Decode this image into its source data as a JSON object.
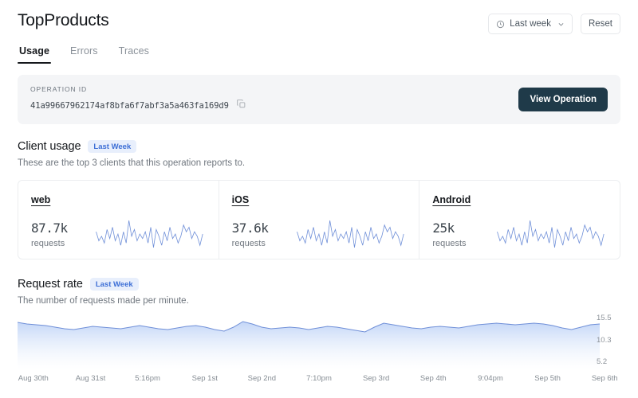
{
  "header": {
    "title": "TopProducts",
    "time_range_label": "Last week",
    "time_range_icon": "clock-icon",
    "chevron_icon": "chevron-down-icon",
    "reset_label": "Reset"
  },
  "tabs": [
    {
      "label": "Usage",
      "active": true
    },
    {
      "label": "Errors",
      "active": false
    },
    {
      "label": "Traces",
      "active": false
    }
  ],
  "operation": {
    "label": "OPERATION ID",
    "id": "41a99667962174af8bfa6f7abf3a5a463fa169d9",
    "copy_icon": "copy-icon",
    "view_button_label": "View Operation"
  },
  "client_usage": {
    "title": "Client usage",
    "badge": "Last Week",
    "description": "These are the top 3 clients that this operation reports to.",
    "cards": [
      {
        "name": "web",
        "value": "87.7k",
        "unit": "requests"
      },
      {
        "name": "iOS",
        "value": "37.6k",
        "unit": "requests"
      },
      {
        "name": "Android",
        "value": "25k",
        "unit": "requests"
      }
    ]
  },
  "request_rate": {
    "title": "Request rate",
    "badge": "Last Week",
    "description": "The number of requests made per minute."
  },
  "colors": {
    "accent_line": "#6f8fd8",
    "area_fill_top": "#c3d6f7",
    "badge_bg": "#e8effc",
    "badge_text": "#3d6fd6",
    "primary_button_bg": "#1f3a49",
    "panel_bg": "#f4f5f7"
  },
  "chart_data": {
    "type": "area",
    "title": "Request rate",
    "subtitle": "The number of requests made per minute.",
    "xlabel": "",
    "ylabel": "",
    "grid": false,
    "legend": false,
    "ytick_labels": [
      "15.5",
      "10.3",
      "5.2"
    ],
    "ytick_values": [
      15.5,
      10.3,
      5.2
    ],
    "ylim": [
      0,
      16.5
    ],
    "xtick_labels": [
      "Aug 30th",
      "Aug 31st",
      "5:16pm",
      "Sep 1st",
      "Sep 2nd",
      "7:10pm",
      "Sep 3rd",
      "Sep 4th",
      "9:04pm",
      "Sep 5th",
      "Sep 6th"
    ],
    "values": [
      15.5,
      15.3,
      15.2,
      15.1,
      14.9,
      14.7,
      14.6,
      14.8,
      15.0,
      14.9,
      14.8,
      14.7,
      14.9,
      15.1,
      14.9,
      14.7,
      14.6,
      14.8,
      15.0,
      15.1,
      14.9,
      14.6,
      14.4,
      14.9,
      15.6,
      15.3,
      14.9,
      14.7,
      14.8,
      14.9,
      14.8,
      14.6,
      14.8,
      15.0,
      14.9,
      14.7,
      14.5,
      14.3,
      14.9,
      15.4,
      15.2,
      15.0,
      14.8,
      14.7,
      14.9,
      15.0,
      14.9,
      14.8,
      15.0,
      15.2,
      15.3,
      15.4,
      15.3,
      15.2,
      15.3,
      15.4,
      15.3,
      15.1,
      14.8,
      14.6,
      14.9,
      15.2,
      15.3
    ]
  },
  "sparkline_data": {
    "type": "line",
    "shared_series_values": [
      9,
      5,
      7,
      4,
      10,
      6,
      11,
      5,
      8,
      3,
      9,
      4,
      14,
      7,
      10,
      5,
      8,
      6,
      9,
      4,
      11,
      2,
      10,
      7,
      3,
      9,
      5,
      11,
      6,
      8,
      4,
      7,
      12,
      9,
      11,
      6,
      9,
      7,
      3,
      8
    ],
    "series": [
      {
        "name": "web"
      },
      {
        "name": "iOS"
      },
      {
        "name": "Android"
      }
    ]
  }
}
